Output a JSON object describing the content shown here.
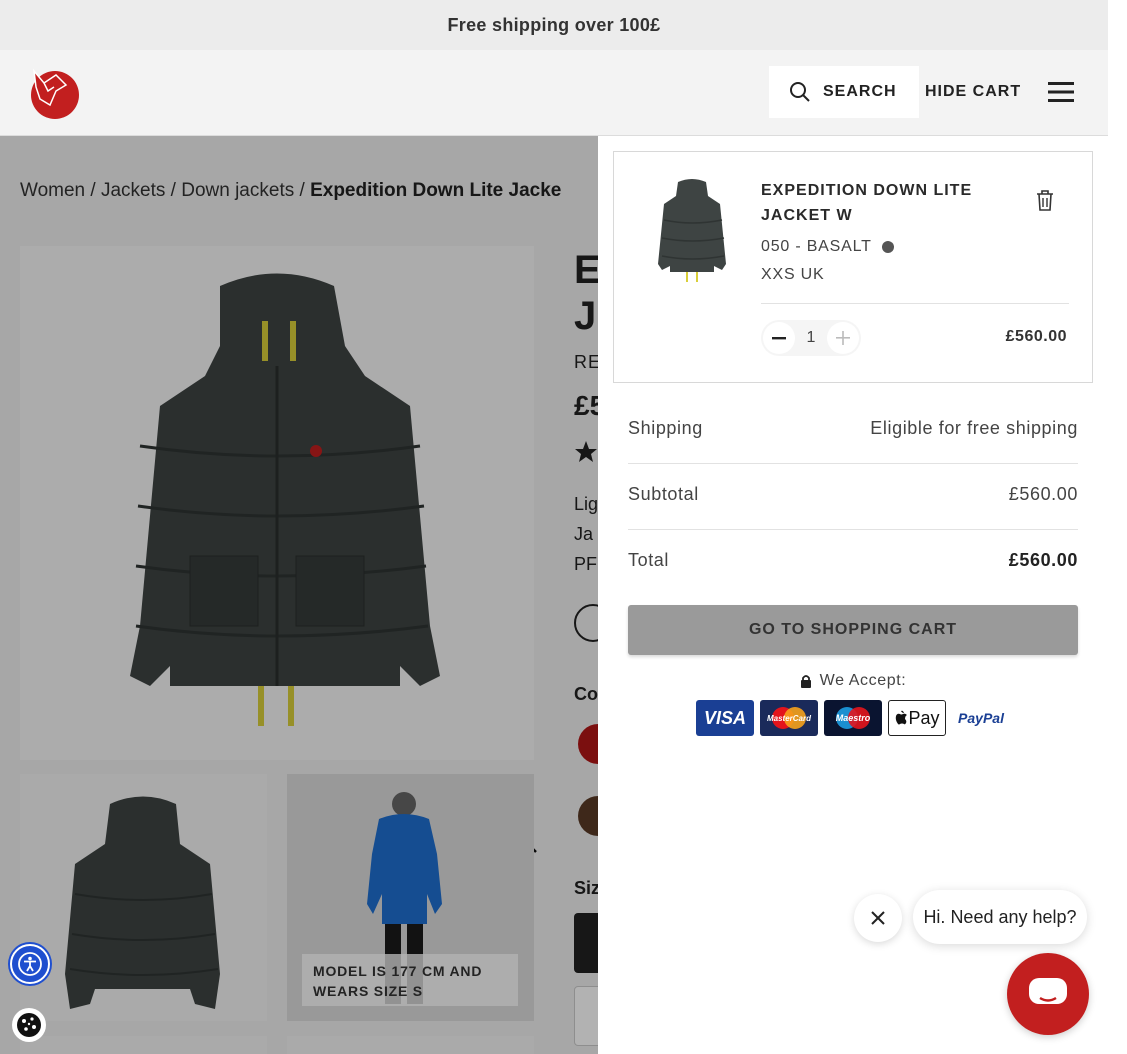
{
  "announcement": "Free shipping over 100£",
  "header": {
    "search_label": "SEARCH",
    "hide_cart_label": "HIDE CART"
  },
  "breadcrumb": {
    "items": [
      "Women",
      "Jackets",
      "Down jackets"
    ],
    "separator": "/",
    "current": "Expedition Down Lite Jacke"
  },
  "product_partial": {
    "title_line1": "E",
    "title_line2": "J",
    "code": "RE",
    "price": "£5",
    "desc_line1": "Lig",
    "desc_line2": "Ja",
    "desc_line3": "PF",
    "color_label": "Co",
    "size_label": "Siz"
  },
  "model_note": "MODEL IS 177 CM AND WEARS SIZE S",
  "cart": {
    "item": {
      "name": "EXPEDITION DOWN LITE JACKET W",
      "color": "050 - BASALT",
      "color_hex": "#555555",
      "size": "XXS UK",
      "quantity": "1",
      "price": "£560.00"
    },
    "shipping_label": "Shipping",
    "shipping_value": "Eligible for free shipping",
    "subtotal_label": "Subtotal",
    "subtotal_value": "£560.00",
    "total_label": "Total",
    "total_value": "£560.00",
    "go_to_cart_label": "GO TO SHOPPING CART",
    "we_accept_label": "We Accept:",
    "payment_methods": [
      "VISA",
      "MasterCard",
      "Maestro",
      "Pay",
      "PayPal"
    ]
  },
  "chat": {
    "help_text": "Hi. Need any help?"
  },
  "colors": {
    "brand_red": "#c21f1f",
    "jacket": "#3e4443",
    "visa_blue": "#1a3f94"
  }
}
